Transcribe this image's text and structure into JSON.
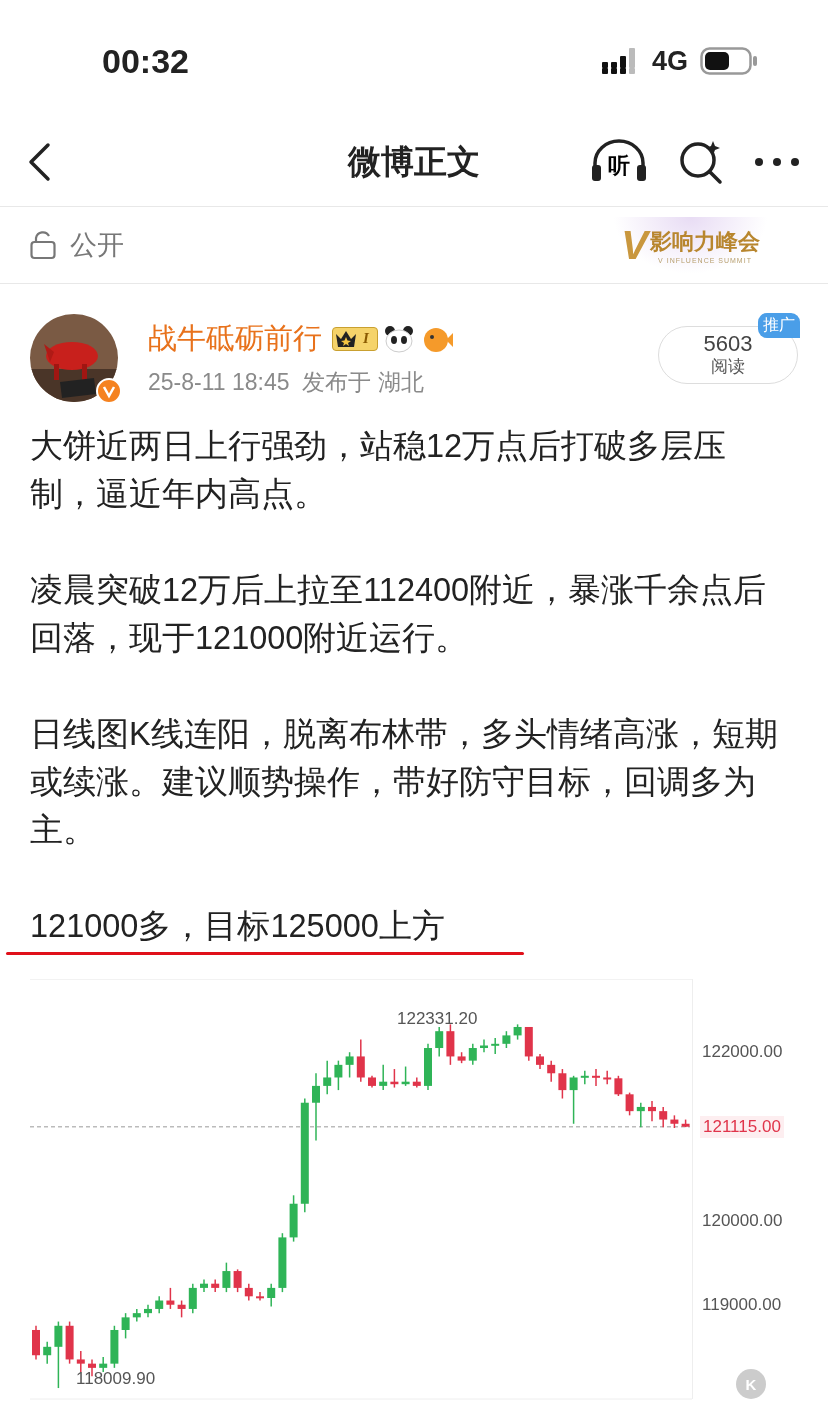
{
  "status_bar": {
    "time": "00:32",
    "network": "4G"
  },
  "nav": {
    "title": "微博正文",
    "listen": "听"
  },
  "visibility": {
    "label": "公开",
    "banner": {
      "mark": "V",
      "title": "影响力峰会",
      "subtitle": "V INFLUENCE SUMMIT"
    }
  },
  "author": {
    "name": "战牛砥砺前行",
    "level": "I",
    "verified": true,
    "meta": "25-8-11 18:45  发布于 湖北"
  },
  "reads": {
    "count": "5603",
    "label": "阅读",
    "badge": "推广"
  },
  "paragraphs": [
    "大饼近两日上行强劲，站稳12万点后打破多层压制，逼近年内高点。",
    "凌晨突破12万后上拉至112400附近，暴涨千余点后回落，现于121000附近运行。",
    "日线图K线连阳，脱离布林带，多头情绪高涨，短期或续涨。建议顺势操作，带好防守目标，回调多为主。",
    "121000多，目标125000上方"
  ],
  "chart": {
    "high_label": "122331.20",
    "low_label": "118009.90",
    "k_button": "K",
    "chart_data": {
      "type": "candlestick",
      "ylim": [
        117880,
        122870
      ],
      "ref_lines": [
        {
          "axis": "y",
          "value": 121115
        }
      ],
      "ohlc": [
        [
          118700,
          118750,
          118350,
          118400
        ],
        [
          118400,
          118560,
          118300,
          118500
        ],
        [
          118500,
          118800,
          118010,
          118750
        ],
        [
          118750,
          118800,
          118300,
          118350
        ],
        [
          118350,
          118450,
          118200,
          118300
        ],
        [
          118300,
          118350,
          118150,
          118250
        ],
        [
          118250,
          118380,
          118200,
          118300
        ],
        [
          118300,
          118750,
          118250,
          118700
        ],
        [
          118700,
          118900,
          118600,
          118850
        ],
        [
          118850,
          118950,
          118800,
          118900
        ],
        [
          118900,
          119000,
          118850,
          118950
        ],
        [
          118950,
          119100,
          118900,
          119050
        ],
        [
          119050,
          119200,
          118950,
          119000
        ],
        [
          119000,
          119050,
          118850,
          118950
        ],
        [
          118950,
          119250,
          118900,
          119200
        ],
        [
          119200,
          119300,
          119150,
          119250
        ],
        [
          119250,
          119300,
          119150,
          119200
        ],
        [
          119200,
          119500,
          119150,
          119400
        ],
        [
          119400,
          119420,
          119150,
          119200
        ],
        [
          119200,
          119250,
          119050,
          119100
        ],
        [
          119100,
          119150,
          119050,
          119080
        ],
        [
          119080,
          119250,
          118980,
          119200
        ],
        [
          119200,
          119850,
          119150,
          119800
        ],
        [
          119800,
          120300,
          119750,
          120200
        ],
        [
          120200,
          121450,
          120100,
          121400
        ],
        [
          121400,
          121750,
          120950,
          121600
        ],
        [
          121600,
          121900,
          121500,
          121700
        ],
        [
          121700,
          121900,
          121550,
          121850
        ],
        [
          121850,
          122000,
          121700,
          121950
        ],
        [
          121950,
          122150,
          121650,
          121700
        ],
        [
          121700,
          121720,
          121580,
          121600
        ],
        [
          121600,
          121850,
          121550,
          121650
        ],
        [
          121650,
          121800,
          121580,
          121620
        ],
        [
          121620,
          121830,
          121600,
          121650
        ],
        [
          121650,
          121700,
          121580,
          121600
        ],
        [
          121600,
          122100,
          121550,
          122050
        ],
        [
          122050,
          122300,
          121950,
          122250
        ],
        [
          122250,
          122331,
          121850,
          121950
        ],
        [
          121950,
          122000,
          121870,
          121900
        ],
        [
          121900,
          122100,
          121850,
          122050
        ],
        [
          122050,
          122150,
          122000,
          122080
        ],
        [
          122080,
          122170,
          121980,
          122100
        ],
        [
          122100,
          122250,
          122050,
          122200
        ],
        [
          122200,
          122331,
          122150,
          122300
        ],
        [
          122300,
          122300,
          121900,
          121950
        ],
        [
          121950,
          121980,
          121800,
          121850
        ],
        [
          121850,
          121900,
          121650,
          121750
        ],
        [
          121750,
          121800,
          121450,
          121550
        ],
        [
          121550,
          121720,
          121150,
          121700
        ],
        [
          121700,
          121780,
          121620,
          121720
        ],
        [
          121720,
          121800,
          121600,
          121700
        ],
        [
          121700,
          121780,
          121620,
          121690
        ],
        [
          121690,
          121720,
          121480,
          121500
        ],
        [
          121500,
          121520,
          121250,
          121300
        ],
        [
          121300,
          121400,
          121110,
          121350
        ],
        [
          121350,
          121420,
          121180,
          121300
        ],
        [
          121300,
          121350,
          121110,
          121200
        ],
        [
          121200,
          121250,
          121100,
          121150
        ],
        [
          121150,
          121200,
          121110,
          121115
        ]
      ],
      "yticks": [
        {
          "value": 122000,
          "label": "122000.00"
        },
        {
          "value": 121115,
          "label": "121115.00"
        },
        {
          "value": 120000,
          "label": "120000.00"
        },
        {
          "value": 119000,
          "label": "119000.00"
        }
      ]
    }
  }
}
